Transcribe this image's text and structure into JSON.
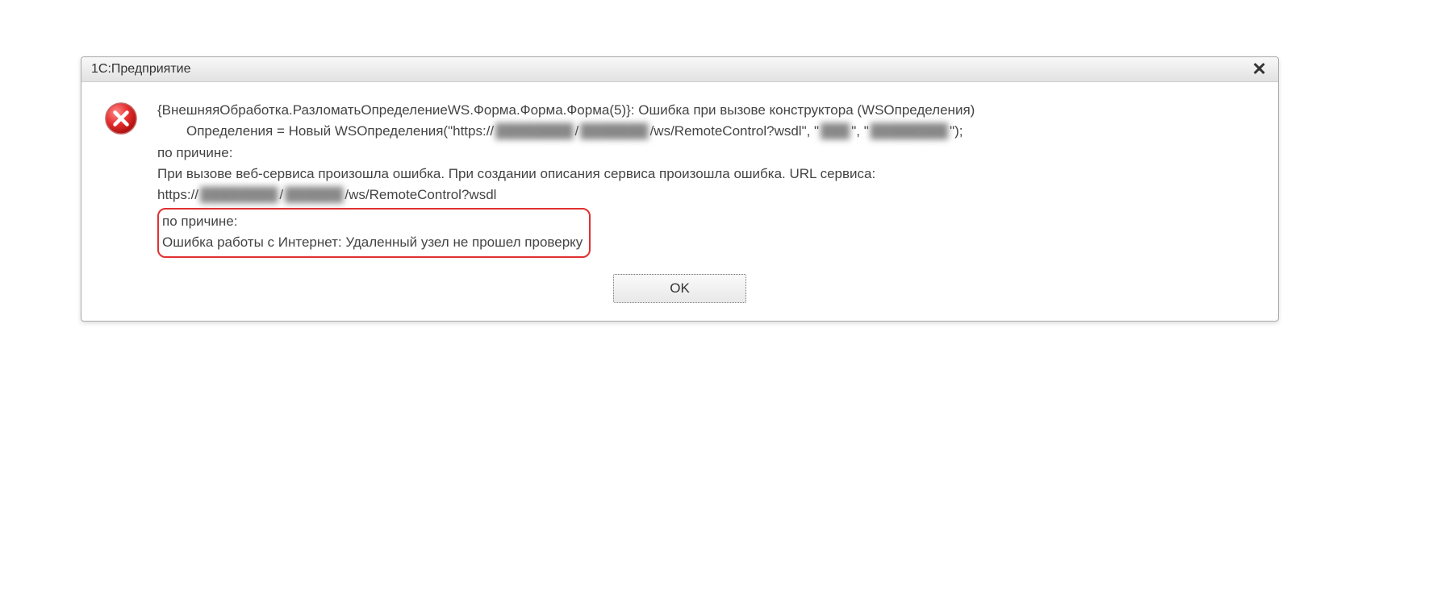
{
  "dialog": {
    "title": "1С:Предприятие",
    "close_symbol": "✕",
    "ok_label": "OK",
    "message": {
      "line1": "{ВнешняяОбработка.РазломатьОпределениеWS.Форма.Форма.Форма(5)}:  Ошибка при вызове конструктора (WSОпределения)",
      "line2_prefix": "Определения = Новый WSОпределения(\"https://",
      "line2_blur1": "████████",
      "line2_mid1": "/",
      "line2_blur2": "███████",
      "line2_mid2": "/ws/RemoteControl?wsdl\", \"",
      "line2_blur3": "███",
      "line2_mid3": "\", \"",
      "line2_blur4": "████████",
      "line2_end": "\");",
      "line3": "по причине:",
      "line4": "При вызове веб-сервиса произошла ошибка. При создании описания сервиса произошла ошибка. URL сервиса:",
      "line5_prefix": "https://",
      "line5_blur1": "████████",
      "line5_mid1": "/",
      "line5_blur2": "██████",
      "line5_end": "/ws/RemoteControl?wsdl",
      "highlight_line1": "по причине:",
      "highlight_line2": "Ошибка работы с Интернет:    Удаленный узел не прошел проверку"
    }
  }
}
